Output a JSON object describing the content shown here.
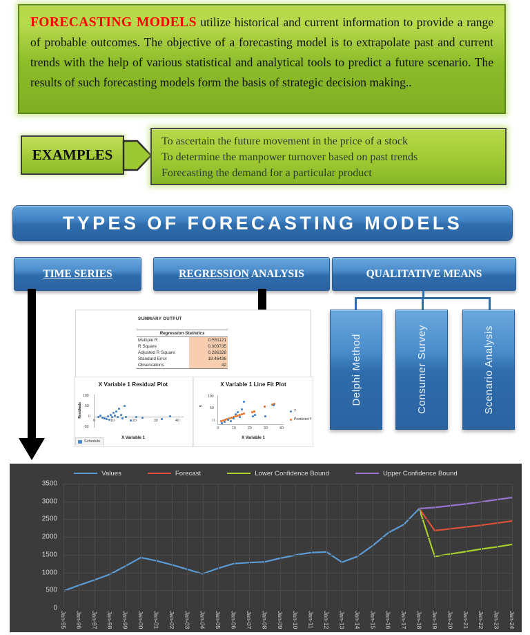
{
  "intro": {
    "highlight": "FORECASTING MODELS",
    "body": " utilize historical and current information to provide a range of probable outcomes. The objective of a forecasting model is to extrapolate past and current trends with the help of various statistical and analytical tools to predict a future scenario. The results of such forecasting models form the basis of strategic decision making.."
  },
  "examples": {
    "label": "EXAMPLES",
    "items": [
      "To ascertain the future movement in the price of a stock",
      "To determine the manpower turnover based on past trends",
      "Forecasting the demand for a particular product"
    ]
  },
  "banner": {
    "title": "TYPES OF FORECASTING MODELS"
  },
  "categories": [
    {
      "underlined": "TIME SERIES",
      "plain": ""
    },
    {
      "underlined": "REGRESSION",
      "plain": " ANALYSIS"
    },
    {
      "underlined": "",
      "plain": "QUALITATIVE MEANS"
    }
  ],
  "qualitative_methods": [
    {
      "label": "Delphi Method"
    },
    {
      "label": "Consumer Survey"
    },
    {
      "label": "Scenario Analysis"
    }
  ],
  "excel": {
    "summary_title": "SUMMARY OUTPUT",
    "stats_header": "Regression Statistics",
    "stats": [
      {
        "name": "Multiple R",
        "value": "0.551121"
      },
      {
        "name": "R Square",
        "value": "0.303735"
      },
      {
        "name": "Adjusted R Square",
        "value": "0.286328"
      },
      {
        "name": "Standard Error",
        "value": "19.46436"
      },
      {
        "name": "Observations",
        "value": "42"
      }
    ],
    "sheet_tab": "Schedule",
    "residual_plot": {
      "title": "X Variable 1  Residual Plot",
      "xlabel": "X Variable 1",
      "ylabel": "Residuals",
      "yticks": [
        "100",
        "50",
        "0",
        "-50"
      ],
      "xticks": [
        "0",
        "10",
        "20",
        "30",
        "40"
      ]
    },
    "line_fit_plot": {
      "title": "X Variable 1 Line Fit  Plot",
      "xlabel": "X Variable 1",
      "ylabel": "Y",
      "yticks": [
        "100",
        "50",
        "0"
      ],
      "xticks": [
        "0",
        "10",
        "20",
        "30",
        "40"
      ],
      "legend": [
        "Y",
        "Predicted Y"
      ]
    }
  },
  "chart_data": {
    "type": "line",
    "title": "",
    "xlabel": "",
    "ylabel": "",
    "ylim": [
      0,
      3500
    ],
    "yticks": [
      0,
      500,
      1000,
      1500,
      2000,
      2500,
      3000,
      3500
    ],
    "grid": true,
    "legend_position": "top",
    "background": "#3b3b3b",
    "colors": {
      "values": "#5b9bd5",
      "forecast": "#e0503a",
      "lower": "#a8cf2b",
      "upper": "#9a74d4"
    },
    "categories": [
      "Jan-95",
      "Jan-96",
      "Jan-97",
      "Jan-98",
      "Jan-99",
      "Jan-00",
      "Jan-01",
      "Jan-02",
      "Jan-03",
      "Jan-04",
      "Jan-05",
      "Jan-06",
      "Jan-07",
      "Jan-08",
      "Jan-09",
      "Jan-10",
      "Jan-11",
      "Jan-12",
      "Jan-13",
      "Jan-14",
      "Jan-15",
      "Jan-16",
      "Jan-17",
      "Jan-18",
      "Jan-19",
      "Jan-20",
      "Jan-21",
      "Jan-22",
      "Jan-23",
      "Jan-24"
    ],
    "series": [
      {
        "name": "Values",
        "values": [
          480,
          640,
          790,
          950,
          1180,
          1420,
          1330,
          1220,
          1090,
          960,
          1120,
          1250,
          1280,
          1300,
          1400,
          1490,
          1560,
          1580,
          1290,
          1450,
          1760,
          2120,
          2350,
          2800,
          null,
          null,
          null,
          null,
          null,
          null
        ]
      },
      {
        "name": "Forecast",
        "values": [
          null,
          null,
          null,
          null,
          null,
          null,
          null,
          null,
          null,
          null,
          null,
          null,
          null,
          null,
          null,
          null,
          null,
          null,
          null,
          null,
          null,
          null,
          null,
          2800,
          2180,
          2230,
          2280,
          2330,
          2390,
          2450
        ]
      },
      {
        "name": "Lower Confidence Bound",
        "values": [
          null,
          null,
          null,
          null,
          null,
          null,
          null,
          null,
          null,
          null,
          null,
          null,
          null,
          null,
          null,
          null,
          null,
          null,
          null,
          null,
          null,
          null,
          null,
          2800,
          1450,
          1520,
          1590,
          1660,
          1720,
          1790
        ]
      },
      {
        "name": "Upper Confidence Bound",
        "values": [
          null,
          null,
          null,
          null,
          null,
          null,
          null,
          null,
          null,
          null,
          null,
          null,
          null,
          null,
          null,
          null,
          null,
          null,
          null,
          null,
          null,
          null,
          null,
          2800,
          2830,
          2880,
          2930,
          2990,
          3050,
          3110
        ]
      }
    ],
    "legend": [
      "Values",
      "Forecast",
      "Lower Confidence Bound",
      "Upper Confidence Bound"
    ]
  }
}
